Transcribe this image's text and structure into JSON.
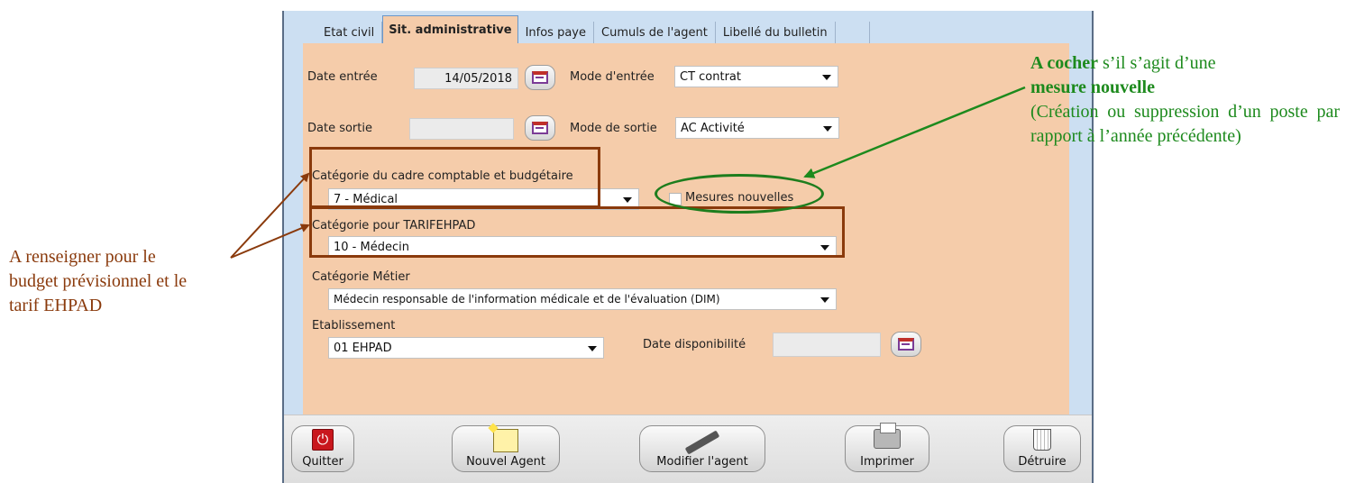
{
  "tabs": [
    "Etat civil",
    "Sit. administrative",
    "Infos paye",
    "Cumuls de l'agent",
    "Libellé du bulletin"
  ],
  "active_tab": "Sit. administrative",
  "form": {
    "date_entree_label": "Date entrée",
    "date_entree_value": "14/05/2018",
    "mode_entree_label": "Mode d'entrée",
    "mode_entree_value": "CT contrat",
    "date_sortie_label": "Date sortie",
    "date_sortie_value": "",
    "mode_sortie_label": "Mode de sortie",
    "mode_sortie_value": "AC Activité",
    "cadre_label": "Catégorie du cadre comptable et budgétaire",
    "cadre_value": "7 - Médical",
    "mesures_label": "Mesures nouvelles",
    "tarif_label": "Catégorie pour TARIFEHPAD",
    "tarif_value": "10 - Médecin",
    "metier_label": "Catégorie Métier",
    "metier_value": "Médecin responsable de l'information médicale et de l'évaluation (DIM)",
    "etab_label": "Etablissement",
    "etab_value": "01 EHPAD",
    "dispo_label": "Date disponibilité",
    "dispo_value": ""
  },
  "toolbar": {
    "quit": "Quitter",
    "new_agent": "Nouvel Agent",
    "edit_agent": "Modifier l'agent",
    "print": "Imprimer",
    "delete": "Détruire"
  },
  "annotations": {
    "left_line1": "A renseigner pour le",
    "left_line2": "budget prévisionnel et le",
    "left_line3": "tarif EHPAD",
    "right_bold1": "A cocher",
    "right_text1": " s’il s’agit d’une",
    "right_bold2": "mesure nouvelle",
    "right_text2": "(Création ou suppression d’un poste par rapport à l’année précédente)"
  },
  "colors": {
    "panel_bg": "#f5ccaa",
    "window_bg": "#ccdff2",
    "annotation_red": "#8a3a0c",
    "annotation_green": "#1d8a1d"
  }
}
